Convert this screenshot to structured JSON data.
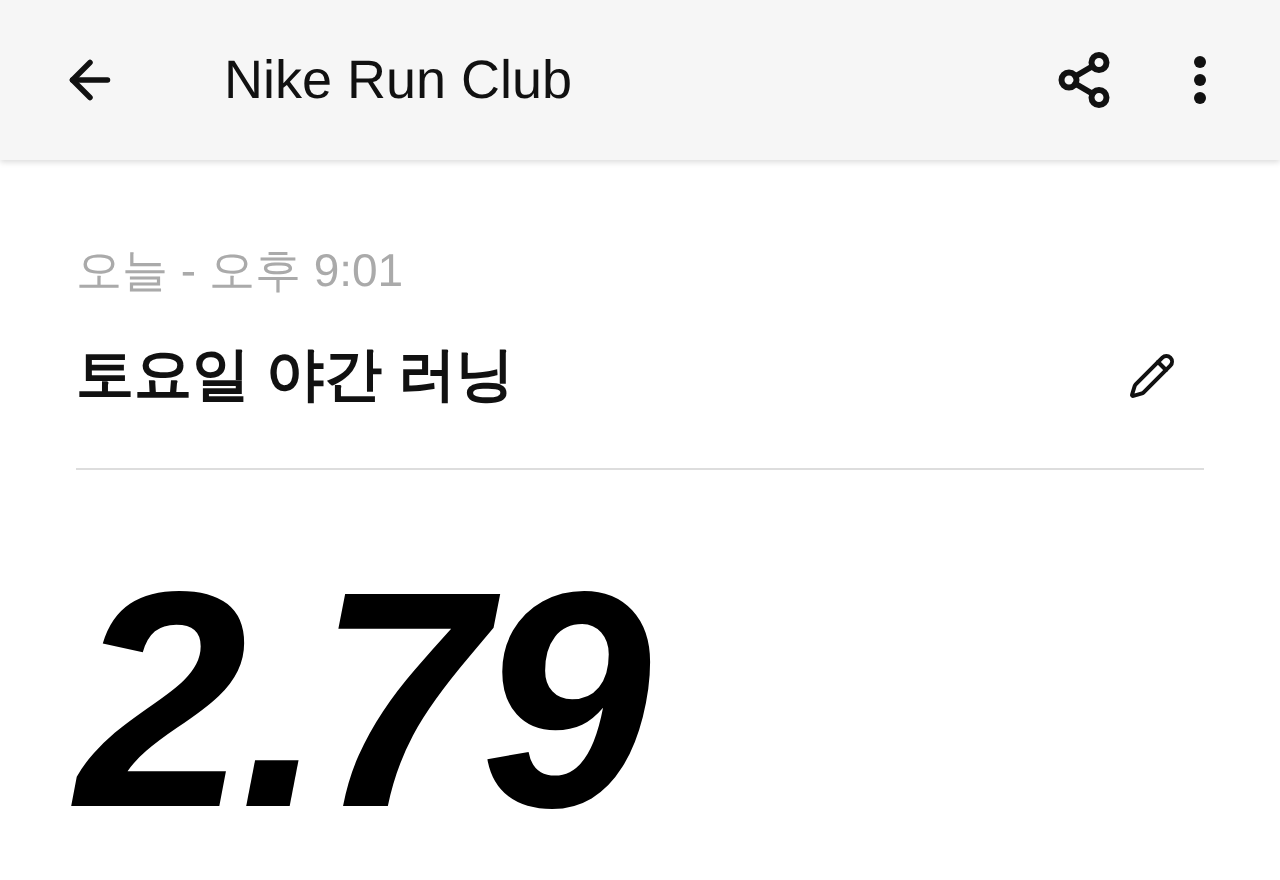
{
  "app_bar": {
    "title": "Nike Run Club"
  },
  "activity": {
    "date": "오늘 - 오후 9:01",
    "name": "토요일 야간 러닝",
    "distance": "2.79"
  }
}
